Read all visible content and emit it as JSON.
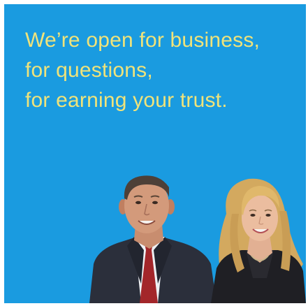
{
  "ad": {
    "background_color": "#1a9be0",
    "headline_color": "#f0e37a",
    "headline_lines": [
      "We’re open for business,",
      "for questions,",
      "for earning your trust."
    ],
    "photo": "man-and-woman-in-business-attire"
  }
}
